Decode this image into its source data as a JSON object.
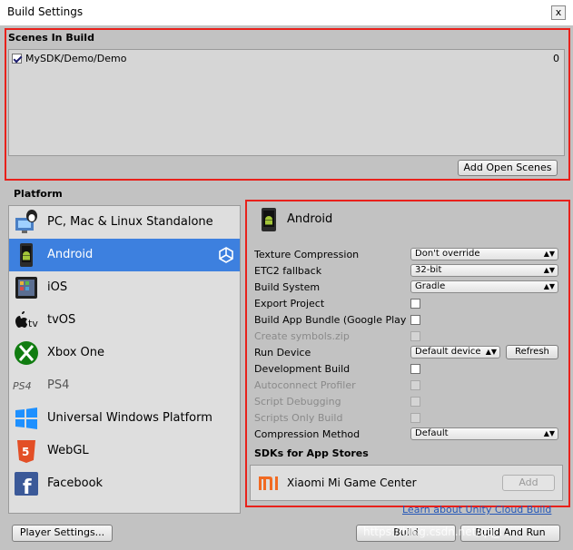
{
  "window": {
    "title": "Build Settings",
    "close_label": "x"
  },
  "scenes": {
    "header": "Scenes In Build",
    "items": [
      {
        "name": "MySDK/Demo/Demo",
        "index": "0",
        "checked": true
      }
    ],
    "add_open_scenes": "Add Open Scenes"
  },
  "platform": {
    "label": "Platform",
    "items": [
      {
        "label": "PC, Mac & Linux Standalone",
        "icon": "pc-mac-linux-icon"
      },
      {
        "label": "Android",
        "icon": "android-icon",
        "selected": true
      },
      {
        "label": "iOS",
        "icon": "ios-icon"
      },
      {
        "label": "tvOS",
        "icon": "tvos-icon"
      },
      {
        "label": "Xbox One",
        "icon": "xbox-icon"
      },
      {
        "label": "PS4",
        "icon": "ps4-icon"
      },
      {
        "label": "Universal Windows Platform",
        "icon": "windows-icon"
      },
      {
        "label": "WebGL",
        "icon": "html5-icon"
      },
      {
        "label": "Facebook",
        "icon": "facebook-icon"
      }
    ]
  },
  "settings": {
    "title": "Android",
    "texture_compression": {
      "label": "Texture Compression",
      "value": "Don't override"
    },
    "etc2_fallback": {
      "label": "ETC2 fallback",
      "value": "32-bit"
    },
    "build_system": {
      "label": "Build System",
      "value": "Gradle"
    },
    "export_project": {
      "label": "Export Project"
    },
    "build_app_bundle": {
      "label": "Build App Bundle (Google Play)"
    },
    "create_symbols": {
      "label": "Create symbols.zip"
    },
    "run_device": {
      "label": "Run Device",
      "value": "Default device",
      "refresh": "Refresh"
    },
    "development_build": {
      "label": "Development Build"
    },
    "autoconnect_profiler": {
      "label": "Autoconnect Profiler"
    },
    "script_debugging": {
      "label": "Script Debugging"
    },
    "scripts_only_build": {
      "label": "Scripts Only Build"
    },
    "compression_method": {
      "label": "Compression Method",
      "value": "Default"
    },
    "sdks_header": "SDKs for App Stores",
    "sdk_item": {
      "name": "Xiaomi Mi Game Center",
      "add": "Add"
    },
    "cloud_link": "Learn about Unity Cloud Build"
  },
  "footer": {
    "player_settings": "Player Settings...",
    "build": "Build",
    "build_and_run": "Build And Run",
    "watermark": "https://blog.csdn.net/qq_..."
  },
  "colors": {
    "selected": "#3d80df",
    "highlight_border": "#e8211b",
    "background": "#c2c2c2"
  }
}
